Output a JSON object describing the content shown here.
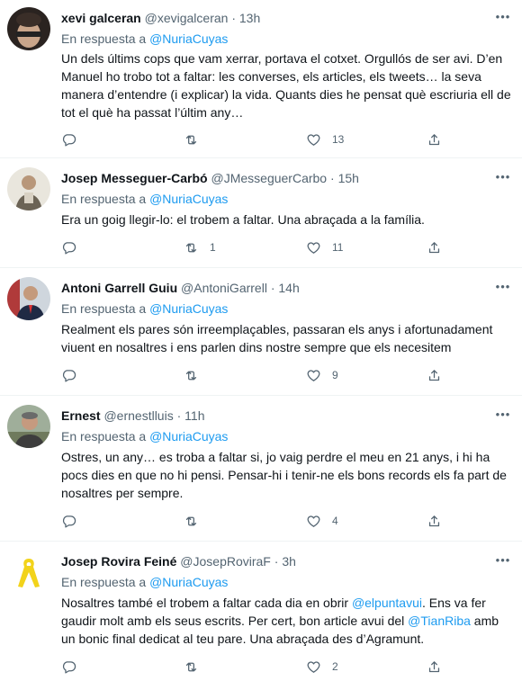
{
  "tweets": [
    {
      "name": "xevi galceran",
      "handle": "@xevigalceran",
      "time": "13h",
      "reply_prefix": "En respuesta a",
      "reply_to": "@NuriaCuyas",
      "text_parts": [
        "Un dels últims cops que vam xerrar, portava el cotxet. Orgullós de ser avi. D’en Manuel ho trobo tot a faltar: les converses, els articles, els tweets… la seva manera d’entendre (i explicar) la vida. Quants dies he pensat què escriuria ell de tot el què ha passat l’últim any…"
      ],
      "retweets": "",
      "likes": "13"
    },
    {
      "name": "Josep Messeguer-Carbó",
      "handle": "@JMesseguerCarbo",
      "time": "15h",
      "reply_prefix": "En respuesta a",
      "reply_to": "@NuriaCuyas",
      "text_parts": [
        "Era un goig llegir-lo: el trobem a faltar. Una abraçada a la família."
      ],
      "retweets": "1",
      "likes": "11"
    },
    {
      "name": "Antoni Garrell Guiu",
      "handle": "@AntoniGarrell",
      "time": "14h",
      "reply_prefix": "En respuesta a",
      "reply_to": "@NuriaCuyas",
      "text_parts": [
        "Realment els pares són irreemplaçables, passaran els anys i afortunadament viuent en nosaltres i ens parlen dins nostre sempre que els necesitem"
      ],
      "retweets": "",
      "likes": "9"
    },
    {
      "name": "Ernest",
      "handle": "@ernestlluis",
      "time": "11h",
      "reply_prefix": "En respuesta a",
      "reply_to": "@NuriaCuyas",
      "text_parts": [
        "Ostres, un any… es troba a faltar si, jo vaig perdre el meu en 21 anys, i hi ha pocs dies en que no hi pensi. Pensar-hi i tenir-ne els bons records els fa part de nosaltres per sempre."
      ],
      "retweets": "",
      "likes": "4"
    },
    {
      "name": "Josep Rovira Feiné",
      "handle": "@JosepRoviraF",
      "time": "3h",
      "reply_prefix": "En respuesta a",
      "reply_to": "@NuriaCuyas",
      "text_parts": [
        "Nosaltres també el trobem a faltar cada dia en obrir ",
        "@elpuntavui",
        ". Ens va fer gaudir molt amb els seus escrits. Per cert, bon article avui del ",
        "@TianRiba",
        " amb un bonic final dedicat al teu pare. Una abraçada des d’Agramunt."
      ],
      "retweets": "",
      "likes": "2"
    }
  ],
  "icons": {
    "reply": "reply-icon",
    "retweet": "retweet-icon",
    "like": "like-icon",
    "share": "share-icon",
    "more": "more-icon"
  },
  "colors": {
    "link": "#1d9bf0",
    "secondary": "#536471",
    "ribbon": "#f2d31b"
  }
}
